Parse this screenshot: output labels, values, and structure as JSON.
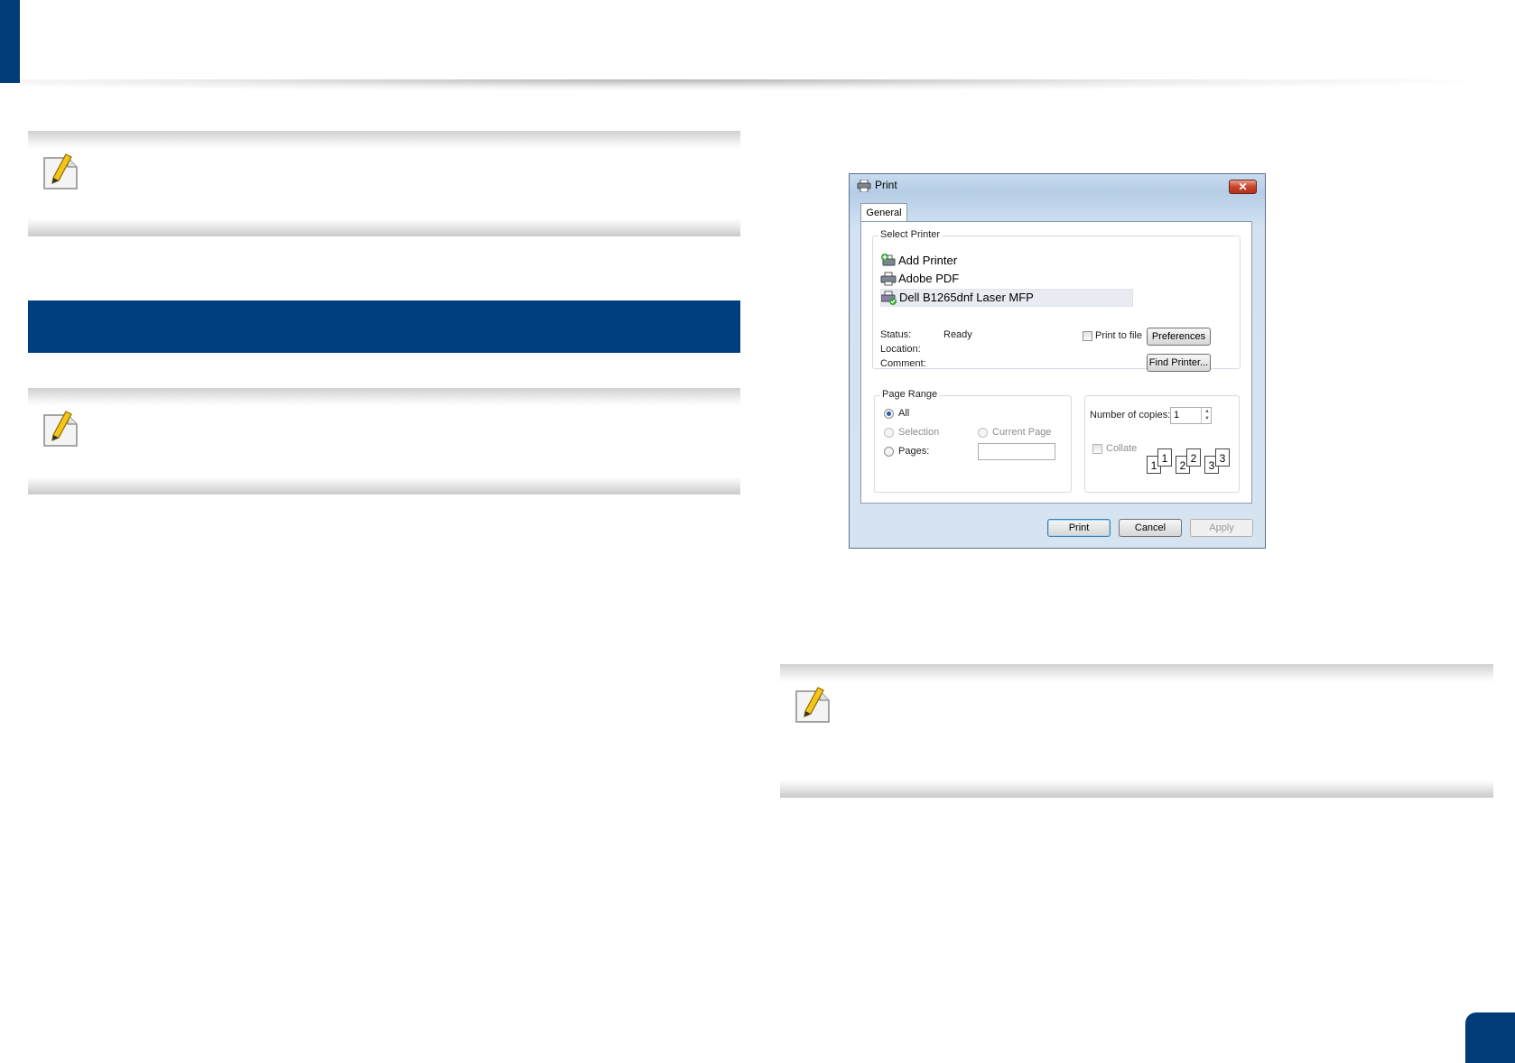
{
  "dialog": {
    "title": "Print",
    "close_glyph": "✕",
    "tab_general": "General",
    "select_printer": {
      "label": "Select Printer",
      "printers": [
        {
          "name": "Add Printer",
          "icon": "add-printer-icon"
        },
        {
          "name": "Adobe PDF",
          "icon": "printer-icon"
        },
        {
          "name": "Dell B1265dnf Laser MFP",
          "icon": "default-printer-icon",
          "selected": true
        }
      ],
      "status_label": "Status:",
      "status_value": "Ready",
      "location_label": "Location:",
      "comment_label": "Comment:",
      "print_to_file": "Print to file",
      "preferences": "Preferences",
      "find_printer": "Find Printer..."
    },
    "page_range": {
      "label": "Page Range",
      "all": "All",
      "selection": "Selection",
      "current_page": "Current Page",
      "pages": "Pages:",
      "pages_value": ""
    },
    "copies": {
      "label": "Number of copies:",
      "value": "1",
      "collate": "Collate",
      "collate_pages": [
        "1",
        "1",
        "2",
        "2",
        "3",
        "3"
      ]
    },
    "buttons": {
      "print": "Print",
      "cancel": "Cancel",
      "apply": "Apply"
    }
  },
  "colors": {
    "brand_blue": "#003f7f",
    "note_gray": "#c9c9c9"
  }
}
